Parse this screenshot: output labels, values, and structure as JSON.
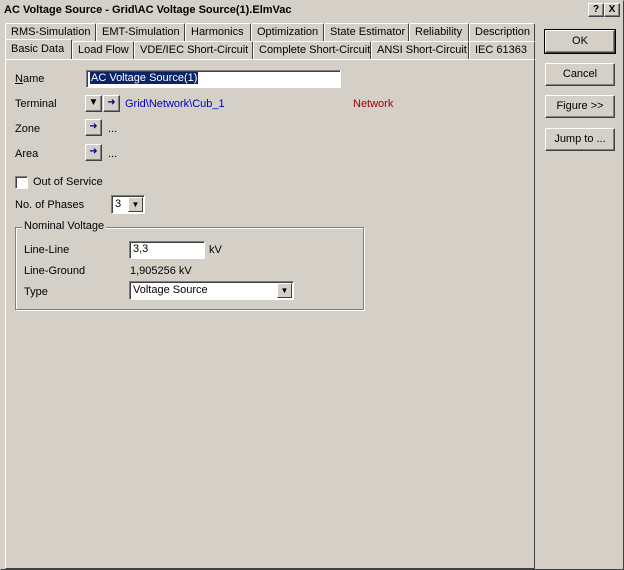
{
  "window": {
    "title": "AC Voltage Source - Grid\\AC Voltage Source(1).ElmVac",
    "help_label": "?",
    "close_label": "X"
  },
  "tabs_row1": [
    "RMS-Simulation",
    "EMT-Simulation",
    "Harmonics",
    "Optimization",
    "State Estimator",
    "Reliability",
    "Description"
  ],
  "tabs_row2": [
    "Basic Data",
    "Load Flow",
    "VDE/IEC Short-Circuit",
    "Complete Short-Circuit",
    "ANSI Short-Circuit",
    "IEC 61363"
  ],
  "active_tab": "Basic Data",
  "buttons": {
    "ok": "OK",
    "cancel": "Cancel",
    "figure": "Figure >>",
    "jump_to": "Jump to ..."
  },
  "form": {
    "name_label": "Name",
    "name_value": "AC Voltage Source(1)",
    "terminal_label": "Terminal",
    "terminal_value": "Grid\\Network\\Cub_1",
    "terminal_network": "Network",
    "zone_label": "Zone",
    "zone_value": "...",
    "area_label": "Area",
    "area_value": "...",
    "out_of_service_label": "Out of Service",
    "out_of_service_checked": false,
    "phases_label": "No. of Phases",
    "phases_value": "3",
    "nominal_voltage": {
      "title": "Nominal Voltage",
      "line_line_label": "Line-Line",
      "line_line_value": "3,3",
      "line_line_unit": "kV",
      "line_ground_label": "Line-Ground",
      "line_ground_value": "1,905256 kV",
      "type_label": "Type",
      "type_value": "Voltage Source"
    }
  },
  "colors": {
    "face": "#d4d0c8",
    "link": "#0000c0",
    "network": "#a00000",
    "selection": "#0a246a"
  }
}
